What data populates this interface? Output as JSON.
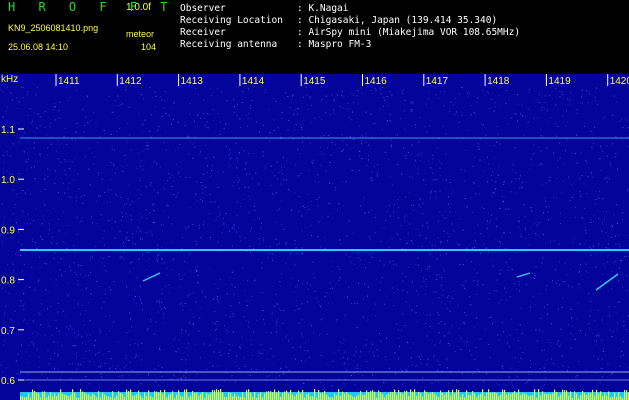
{
  "header": {
    "brand": "H R O F F T",
    "version": "1.0.0f",
    "filename": "KN9_2506081410.png",
    "mode": "meteor",
    "timestamp": "25.06.08 14:10",
    "count": "104",
    "info": [
      {
        "label": "Observer",
        "value": ": K.Nagai"
      },
      {
        "label": "Receiving Location",
        "value": ": Chigasaki, Japan (139.414 35.340)"
      },
      {
        "label": "Receiver",
        "value": ": AirSpy mini (Miakejima VOR 108.65MHz)"
      },
      {
        "label": "Receiving antenna",
        "value": ": Maspro FM-3"
      }
    ]
  },
  "spectrogram": {
    "unit": "kHz",
    "time_ticks": [
      "1411",
      "1412",
      "1413",
      "1414",
      "1415",
      "1416",
      "1417",
      "1418",
      "1419",
      "1420"
    ],
    "freq_ticks": [
      "1.1",
      "1.0",
      "0.9",
      "0.8",
      "0.7",
      "0.6"
    ],
    "colors": {
      "background": "#04049a",
      "noise": "#4a5cff",
      "carrier": "#35c8ff",
      "baseline": "#1ec8ff",
      "bars": "#e6ff20"
    }
  }
}
